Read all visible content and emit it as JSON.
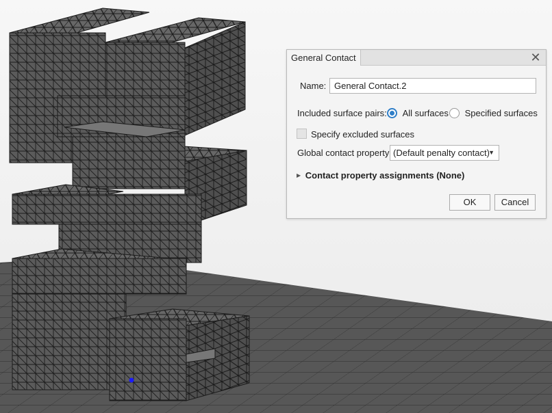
{
  "dialog": {
    "tab_title": "General Contact",
    "close_glyph": "✕",
    "name_label": "Name:",
    "name_value": "General Contact.2",
    "pairs_label": "Included surface pairs:",
    "pairs_options": [
      "All surfaces",
      "Specified surfaces"
    ],
    "pairs_selected": "All surfaces",
    "exclude_label": "Specify excluded surfaces",
    "exclude_checked": false,
    "global_label": "Global contact property:",
    "global_value": "(Default penalty contact)",
    "assignments_label": "Contact property assignments (None)",
    "expander_glyph": "▶",
    "ok_label": "OK",
    "cancel_label": "Cancel"
  },
  "icons": [
    "close-icon",
    "radio-selected-icon",
    "radio-unselected-icon",
    "checkbox-icon",
    "dropdown-arrow-icon",
    "expand-triangle-icon"
  ],
  "colors": {
    "mesh_face": "#5a5a5a",
    "mesh_line": "#1c1c1c",
    "floor": "#565656",
    "background": "#f2f2f2",
    "radio_accent": "#2f7ec7",
    "marker": "#1a1aff"
  }
}
